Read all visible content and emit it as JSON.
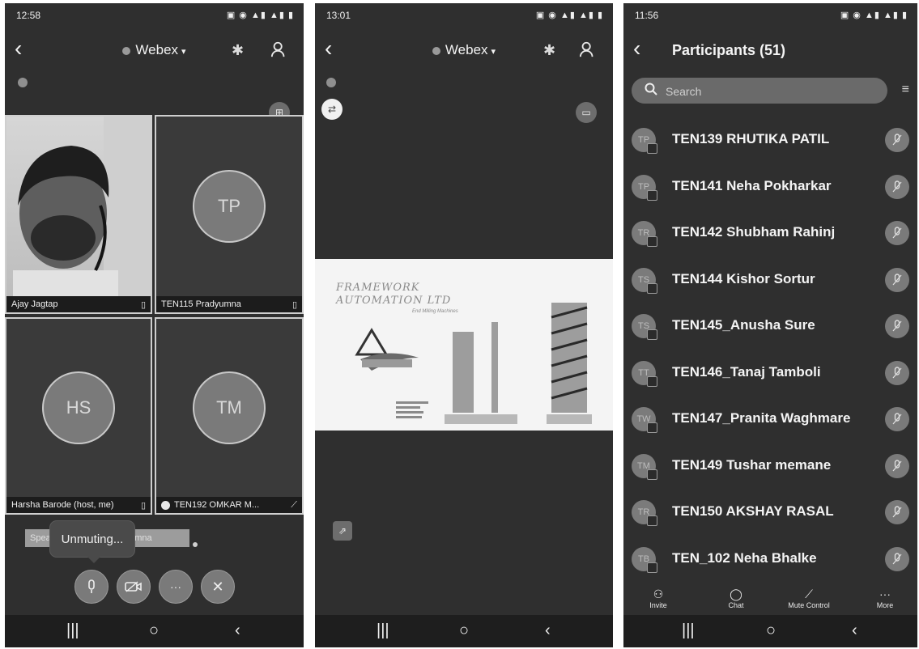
{
  "phone1": {
    "status_time": "12:58",
    "title": "Webex",
    "tiles": [
      {
        "name": "Ajay Jagtap",
        "initials": ""
      },
      {
        "name": "TEN115 Pradyumna",
        "initials": "TP"
      },
      {
        "name": "Harsha Barode (host, me)",
        "initials": "HS"
      },
      {
        "name": "TEN192 OMKAR M...",
        "initials": "TM"
      }
    ],
    "speaking_label": "Speaking: TEN115 Pradyumna",
    "unmuting_tooltip": "Unmuting...",
    "controls": [
      "mic-icon",
      "video-icon",
      "more-icon",
      "end-call-icon"
    ]
  },
  "phone2": {
    "status_time": "13:01",
    "title": "Webex",
    "share": {
      "company_line1": "FRAMEWORK",
      "company_line2": "AUTOMATION LTD",
      "tagline": "End Milling Machines"
    }
  },
  "phone3": {
    "status_time": "11:56",
    "title": "Participants (51)",
    "search_placeholder": "Search",
    "participants": [
      {
        "name": "TEN139 RHUTIKA PATIL",
        "initials": "TP"
      },
      {
        "name": "TEN141 Neha Pokharkar",
        "initials": "TP"
      },
      {
        "name": "TEN142 Shubham Rahinj",
        "initials": "TR"
      },
      {
        "name": "TEN144 Kishor Sortur",
        "initials": "TS"
      },
      {
        "name": "TEN145_Anusha Sure",
        "initials": "TS"
      },
      {
        "name": "TEN146_Tanaj Tamboli",
        "initials": "TT"
      },
      {
        "name": "TEN147_Pranita Waghmare",
        "initials": "TW"
      },
      {
        "name": "TEN149 Tushar memane",
        "initials": "TM"
      },
      {
        "name": "TEN150 AKSHAY RASAL",
        "initials": "TR"
      },
      {
        "name": "TEN_102 Neha Bhalke",
        "initials": "TB"
      }
    ],
    "tabs": [
      {
        "label": "Invite",
        "icon": "person-icon"
      },
      {
        "label": "Chat",
        "icon": "chat-icon"
      },
      {
        "label": "Mute Control",
        "icon": "mic-off-icon"
      },
      {
        "label": "More",
        "icon": "more-icon"
      }
    ]
  }
}
